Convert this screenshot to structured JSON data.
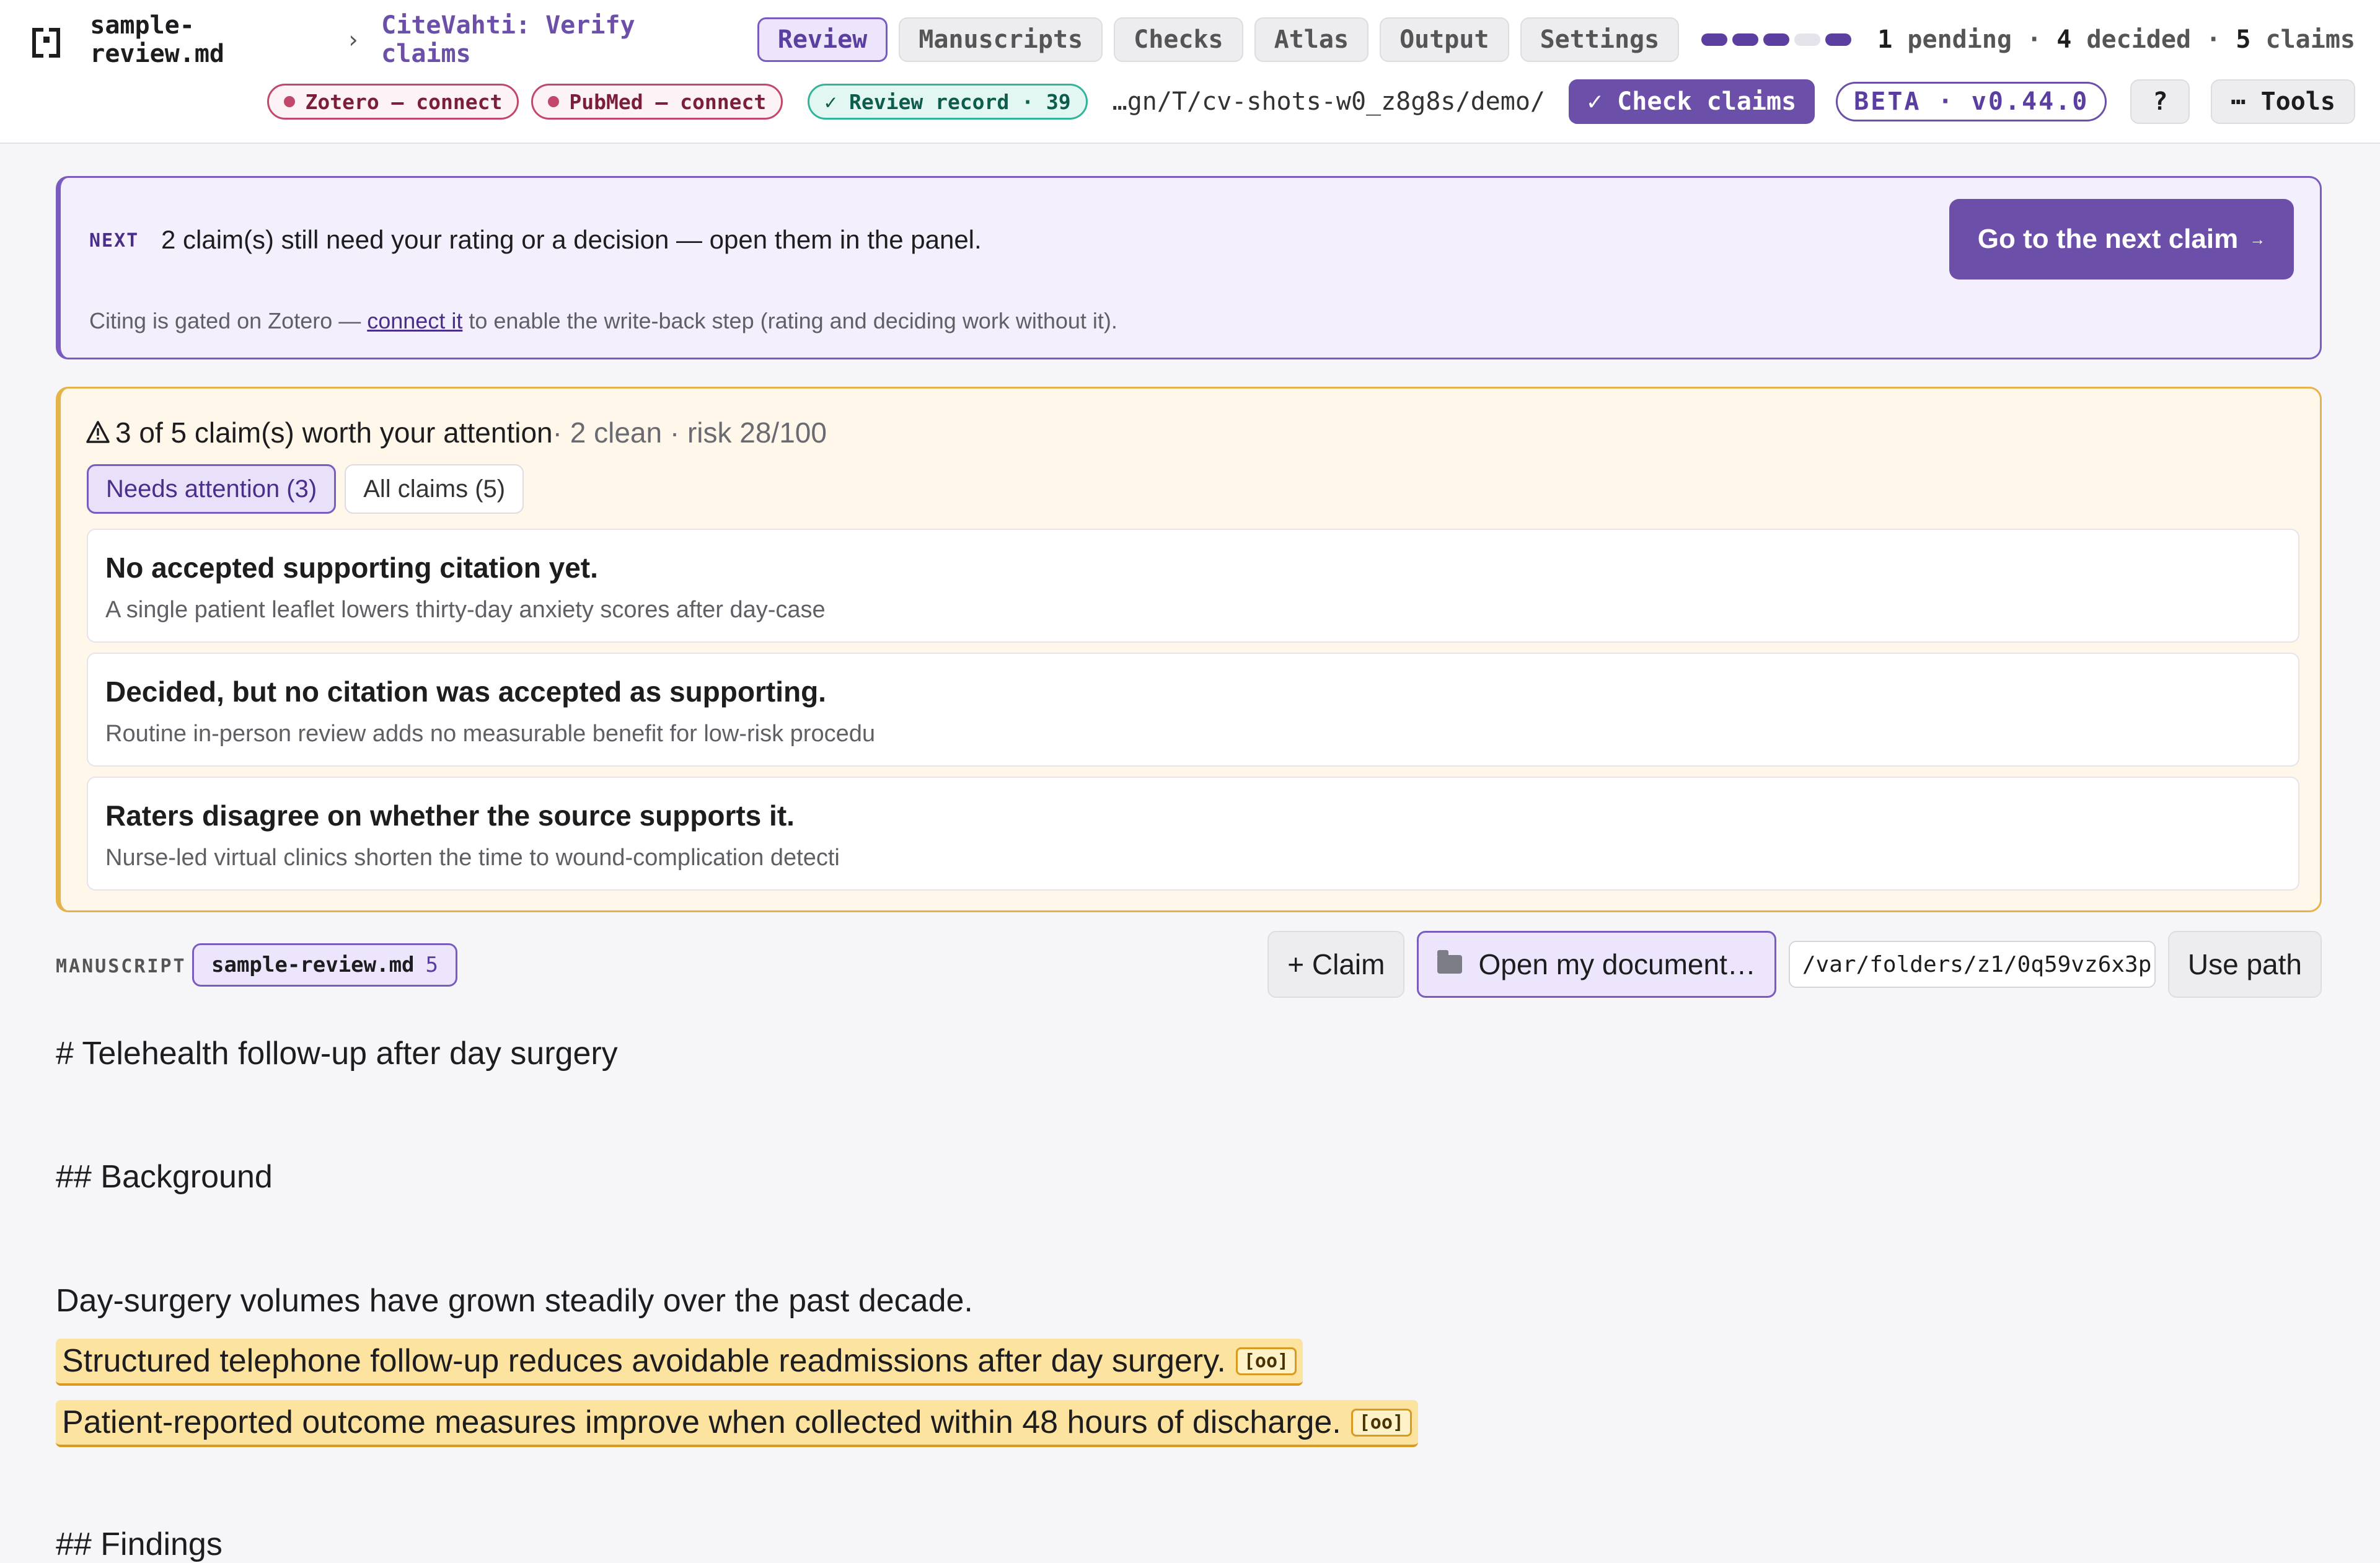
{
  "header": {
    "file_name": "sample-review.md",
    "crumb_separator": "›",
    "app_title": "CiteVahti: Verify claims",
    "tabs": [
      {
        "label": "Review",
        "active": true
      },
      {
        "label": "Manuscripts",
        "active": false
      },
      {
        "label": "Checks",
        "active": false
      },
      {
        "label": "Atlas",
        "active": false
      },
      {
        "label": "Output",
        "active": false
      },
      {
        "label": "Settings",
        "active": false
      }
    ],
    "progress_segments": [
      "filled",
      "filled",
      "filled",
      "empty",
      "filled"
    ],
    "counts": {
      "pending_n": "1",
      "pending_label": "pending",
      "decided_n": "4",
      "decided_label": "decided",
      "claims_n": "5",
      "claims_label": "claims",
      "separator": "·"
    },
    "zotero_pill": "Zotero — connect",
    "pubmed_pill": "PubMed — connect",
    "review_record": "✓ Review record · 39",
    "path": "…gn/T/cv-shots-w0_z8g8s/demo/",
    "check_claims": "✓ Check claims",
    "beta": "BETA · v0.44.0",
    "help": "?",
    "tools": "⋯ Tools"
  },
  "next_panel": {
    "label": "NEXT",
    "message": "2 claim(s) still need your rating or a decision — open them in the panel.",
    "note_before": "Citing is gated on Zotero — ",
    "note_link": "connect it",
    "note_after": " to enable the write-back step (rating and deciding work without it).",
    "button": "Go to the next claim",
    "button_arrow": "→"
  },
  "attention": {
    "headline": "3 of 5 claim(s) worth your attention",
    "summary": " · 2 clean · risk 28/100",
    "filters": [
      {
        "label": "Needs attention (3)",
        "active": true
      },
      {
        "label": "All claims (5)",
        "active": false
      }
    ],
    "claims": [
      {
        "title": "No accepted supporting citation yet.",
        "text": "A single patient leaflet lowers thirty-day anxiety scores after day-case"
      },
      {
        "title": "Decided, but no citation was accepted as supporting.",
        "text": "Routine in-person review adds no measurable benefit for low-risk procedu"
      },
      {
        "title": "Raters disagree on whether the source supports it.",
        "text": "Nurse-led virtual clinics shorten the time to wound-complication detecti"
      }
    ]
  },
  "manuscript": {
    "label": "MANUSCRIPT",
    "file": "sample-review.md",
    "count": "5",
    "add_claim": "+ Claim",
    "open_document": "Open my document…",
    "path_value": "/var/folders/z1/0q59vz6x3p",
    "use_path": "Use path"
  },
  "document": {
    "title": "# Telehealth follow-up after day surgery",
    "background": "## Background",
    "para1": "Day-surgery volumes have grown steadily over the past decade.",
    "claim1": "Structured telephone follow-up reduces avoidable readmissions after day surgery.",
    "claim1_tag": "[oo]",
    "claim2": "Patient-reported outcome measures improve when collected within 48 hours of discharge.",
    "claim2_tag": "[oo]",
    "findings": "## Findings"
  },
  "colors": {
    "accent": "#6b4fa8",
    "attention_border": "#e6b24a",
    "highlight": "#fce3a0",
    "connect_red": "#c2476a",
    "record_teal": "#33b49a"
  }
}
